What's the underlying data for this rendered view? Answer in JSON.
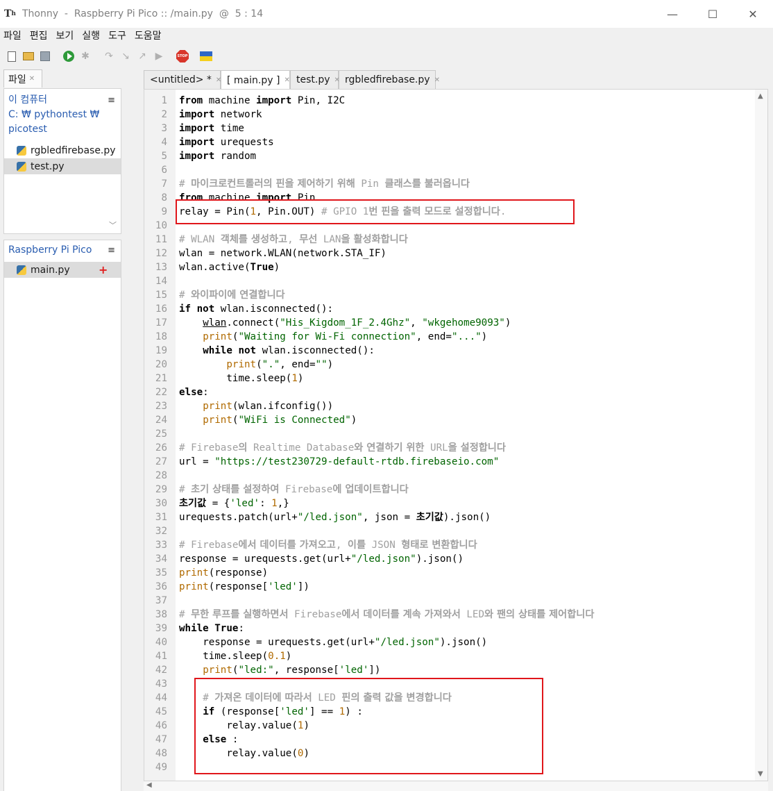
{
  "window": {
    "app_name": "Thonny",
    "title": "Thonny  -  Raspberry Pi Pico :: /main.py  @  5 : 14",
    "minimize": "—",
    "maximize": "☐",
    "close": "✕"
  },
  "menu": [
    "파일",
    "편집",
    "보기",
    "실행",
    "도구",
    "도움말"
  ],
  "toolbar": {
    "icons": [
      "new-file-icon",
      "open-file-icon",
      "save-icon",
      "run-icon",
      "debug-icon",
      "step-over-icon",
      "step-into-icon",
      "step-out-icon",
      "resume-icon",
      "stop-icon",
      "ukraine-flag-icon"
    ],
    "stop_label": "STOP"
  },
  "left_tabs": {
    "files": "파일"
  },
  "files_panel": {
    "title": "이 컴퓨터",
    "path": "C: ₩ pythontest ₩ picotest",
    "items": [
      "rgbledfirebase.py",
      "test.py"
    ],
    "selected": "test.py"
  },
  "device_panel": {
    "title": "Raspberry Pi Pico",
    "items": [
      "main.py"
    ],
    "selected": "main.py"
  },
  "editor_tabs": [
    {
      "label": "<untitled> *",
      "active": false
    },
    {
      "label": "[ main.py ]",
      "active": true
    },
    {
      "label": "test.py",
      "active": false
    },
    {
      "label": "rgbledfirebase.py",
      "active": false
    }
  ],
  "code": {
    "l1": [
      "from",
      " machine ",
      "import",
      " Pin, I2C"
    ],
    "l2": [
      "import",
      " network"
    ],
    "l3": [
      "import",
      " time"
    ],
    "l4": [
      "import",
      " urequests"
    ],
    "l5": [
      "import",
      " random"
    ],
    "l7": [
      "# ",
      "마이크로컨트롤러의 핀을 제어하기 위해",
      " Pin ",
      "클래스를 불러옵니다"
    ],
    "l8": [
      "from",
      " machine ",
      "import",
      " Pin"
    ],
    "l9": [
      "relay = Pin(",
      "1",
      ", Pin.OUT) ",
      "# GPIO 1",
      "번 핀을 출력 모드로 설정합니다",
      "."
    ],
    "l11": [
      "# WLAN ",
      "객체를 생성하고",
      ", ",
      "무선",
      " LAN",
      "을 활성화합니다"
    ],
    "l12": [
      "wlan = network.WLAN(network.STA_IF)"
    ],
    "l13": [
      "wlan.active(",
      "True",
      ")"
    ],
    "l15": [
      "# ",
      "와이파이에 연결합니다"
    ],
    "l16": [
      "if",
      " ",
      "not",
      " wlan.isconnected():"
    ],
    "l17": [
      "wlan",
      ".connect(",
      "\"His_Kigdom_1F_2.4Ghz\"",
      ", ",
      "\"wkgehome9093\"",
      ")"
    ],
    "l18": [
      "print",
      "(",
      "\"Waiting for Wi-Fi connection\"",
      ", end=",
      "\"...\"",
      ")"
    ],
    "l19": [
      "while",
      " ",
      "not",
      " wlan.isconnected():"
    ],
    "l20": [
      "print",
      "(",
      "\".\"",
      ", end=",
      "\"\"",
      ")"
    ],
    "l21": [
      "time.sleep(",
      "1",
      ")"
    ],
    "l22": [
      "else",
      ":"
    ],
    "l23": [
      "print",
      "(wlan.ifconfig())"
    ],
    "l24": [
      "print",
      "(",
      "\"WiFi is Connected\"",
      ")"
    ],
    "l26": [
      "# Firebase",
      "의",
      " Realtime Database",
      "와 연결하기 위한",
      " URL",
      "을 설정합니다"
    ],
    "l27": [
      "url = ",
      "\"https://test230729-default-rtdb.firebaseio.com\""
    ],
    "l29": [
      "# ",
      "초기 상태를 설정하여",
      " Firebase",
      "에 업데이트합니다"
    ],
    "l30": [
      "초기값",
      " = {",
      "'led'",
      ": ",
      "1",
      ",}"
    ],
    "l31": [
      "urequests.patch(url+",
      "\"/led.json\"",
      ", json = ",
      "초기값",
      ").json()"
    ],
    "l33": [
      "# Firebase",
      "에서 데이터를 가져오고",
      ", ",
      "이를",
      " JSON ",
      "형태로 변환합니다"
    ],
    "l34": [
      "response = urequests.get(url+",
      "\"/led.json\"",
      ").json()"
    ],
    "l35": [
      "print",
      "(response)"
    ],
    "l36": [
      "print",
      "(response[",
      "'led'",
      "])"
    ],
    "l38": [
      "# ",
      "무한 루프를 실행하면서",
      " Firebase",
      "에서 데이터를 계속 가져와서",
      " LED",
      "와 팬의 상태를 제어합니다"
    ],
    "l39": [
      "while",
      " ",
      "True",
      ":"
    ],
    "l40": [
      "response = urequests.get(url+",
      "\"/led.json\"",
      ").json()"
    ],
    "l41": [
      "time.sleep(",
      "0.1",
      ")"
    ],
    "l42": [
      "print",
      "(",
      "\"led:\"",
      ", response[",
      "'led'",
      "])"
    ],
    "l44": [
      "# ",
      "가져온 데이터에 따라서",
      " LED ",
      "핀의 출력 값을 변경합니다"
    ],
    "l45": [
      "if",
      " (response[",
      "'led'",
      "] == ",
      "1",
      ") :"
    ],
    "l46": [
      "relay.value(",
      "1",
      ")"
    ],
    "l47": [
      "else",
      " :"
    ],
    "l48": [
      "relay.value(",
      "0",
      ")"
    ]
  },
  "line_numbers": [
    "1",
    "2",
    "3",
    "4",
    "5",
    "6",
    "7",
    "8",
    "9",
    "10",
    "11",
    "12",
    "13",
    "14",
    "15",
    "16",
    "17",
    "18",
    "19",
    "20",
    "21",
    "22",
    "23",
    "24",
    "25",
    "26",
    "27",
    "28",
    "29",
    "30",
    "31",
    "32",
    "33",
    "34",
    "35",
    "36",
    "37",
    "38",
    "39",
    "40",
    "41",
    "42",
    "43",
    "44",
    "45",
    "46",
    "47",
    "48",
    "49"
  ],
  "colors": {
    "keyword": "#000000",
    "string": "#006400",
    "number": "#b06a00",
    "comment": "#a0a0a0",
    "highlight_box": "#e0161b",
    "panel_title": "#2a5db0"
  }
}
